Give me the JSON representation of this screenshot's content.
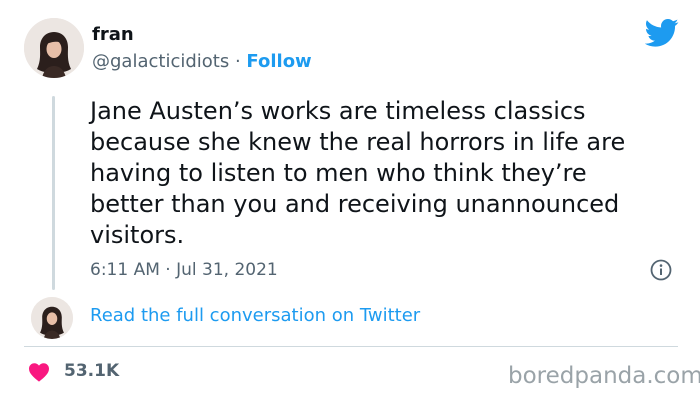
{
  "author": {
    "name": "fran",
    "handle": "@galacticidiots",
    "separator": "·",
    "follow_label": "Follow"
  },
  "tweet": {
    "lines": [
      "Jane Austen’s works are timeless classics",
      "because she knew the real horrors in life are",
      "having to listen to men who think they’re",
      "better than you and receiving unannounced",
      "visitors."
    ],
    "timestamp": "6:11 AM · Jul 31, 2021"
  },
  "thread": {
    "read_link": "Read the full conversation on Twitter"
  },
  "engagement": {
    "likes": "53.1K"
  },
  "watermark": "boredpanda.com",
  "icons": {
    "brand": "twitter-bird-icon",
    "info": "info-icon",
    "like": "heart-icon"
  },
  "colors": {
    "accent": "#1d9bf0",
    "heart": "#f91880",
    "text": "#0f1419",
    "muted": "#536471"
  }
}
